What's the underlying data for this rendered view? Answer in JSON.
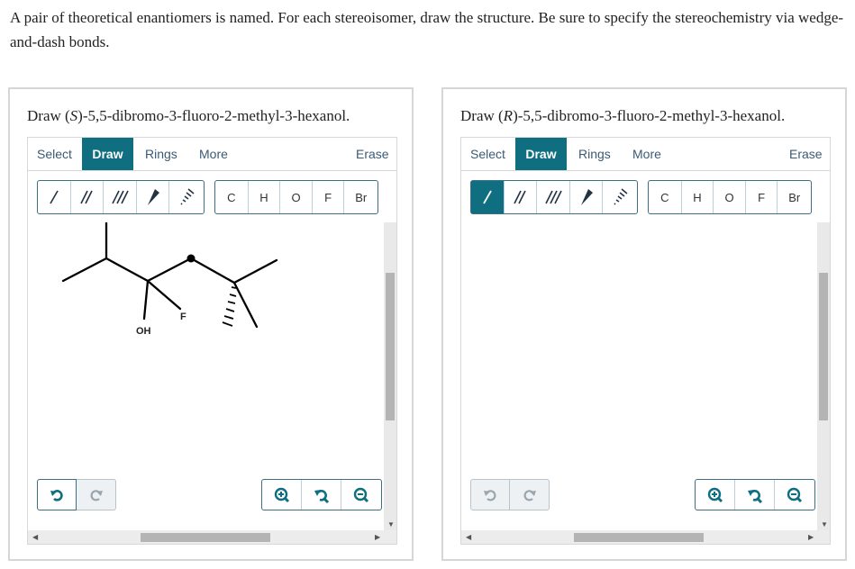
{
  "instructions": "A pair of theoretical enantiomers is named. For each stereoisomer, draw the structure. Be sure to specify the stereochemistry via wedge-and-dash bonds.",
  "panels": [
    {
      "prompt_pre": "Draw (",
      "prompt_config": "S",
      "prompt_post": ")-5,5-dibromo-3-fluoro-2-methyl-3-hexanol.",
      "tabs": {
        "select": "Select",
        "draw": "Draw",
        "rings": "Rings",
        "more": "More",
        "erase": "Erase"
      },
      "atoms": [
        "C",
        "H",
        "O",
        "F",
        "Br"
      ],
      "active_bond_tool": "none",
      "undo_enabled": true,
      "redo_enabled": false,
      "molecule_labels": {
        "oh": "OH",
        "f": "F"
      }
    },
    {
      "prompt_pre": "Draw (",
      "prompt_config": "R",
      "prompt_post": ")-5,5-dibromo-3-fluoro-2-methyl-3-hexanol.",
      "tabs": {
        "select": "Select",
        "draw": "Draw",
        "rings": "Rings",
        "more": "More",
        "erase": "Erase"
      },
      "atoms": [
        "C",
        "H",
        "O",
        "F",
        "Br"
      ],
      "active_bond_tool": "single-bond",
      "undo_enabled": false,
      "redo_enabled": false
    }
  ],
  "icons": {
    "single_bond": "single-bond-icon",
    "double_bond": "double-bond-icon",
    "triple_bond": "triple-bond-icon",
    "wedge": "wedge-bond-icon",
    "dash": "dash-bond-icon",
    "undo": "undo-icon",
    "redo": "redo-icon",
    "zoom_in": "zoom-in-icon",
    "reset_zoom": "reset-zoom-icon",
    "zoom_out": "zoom-out-icon"
  },
  "colors": {
    "accent": "#0f6e80",
    "tab_text": "#3b5a74",
    "border": "#3d6e86"
  }
}
